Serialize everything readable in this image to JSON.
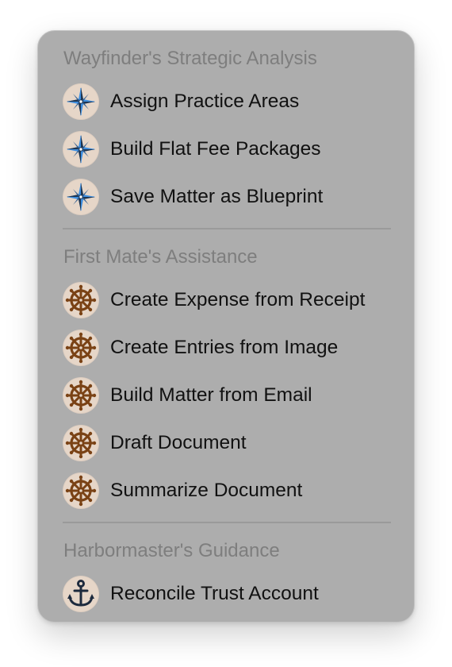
{
  "menu": {
    "sections": [
      {
        "header": "Wayfinder's Strategic Analysis",
        "icon": "compass-rose-icon",
        "items": [
          {
            "label": "Assign Practice Areas"
          },
          {
            "label": "Build Flat Fee Packages"
          },
          {
            "label": "Save Matter as Blueprint"
          }
        ]
      },
      {
        "header": "First Mate's Assistance",
        "icon": "ship-wheel-icon",
        "items": [
          {
            "label": "Create Expense from Receipt"
          },
          {
            "label": "Create Entries from Image"
          },
          {
            "label": "Build Matter from Email"
          },
          {
            "label": "Draft Document"
          },
          {
            "label": "Summarize Document"
          }
        ]
      },
      {
        "header": "Harbormaster's Guidance",
        "icon": "anchor-icon",
        "items": [
          {
            "label": "Reconcile Trust Account"
          }
        ]
      }
    ]
  },
  "colors": {
    "menu_background": "#adadad",
    "header_text": "#7e7e7e",
    "item_text": "#111111",
    "icon_background": "#e6d6c8",
    "compass_blue": "#3d8ee0",
    "compass_dark": "#1f3550",
    "wheel_brown": "#7a4215",
    "anchor_navy": "#1d2a3d"
  }
}
